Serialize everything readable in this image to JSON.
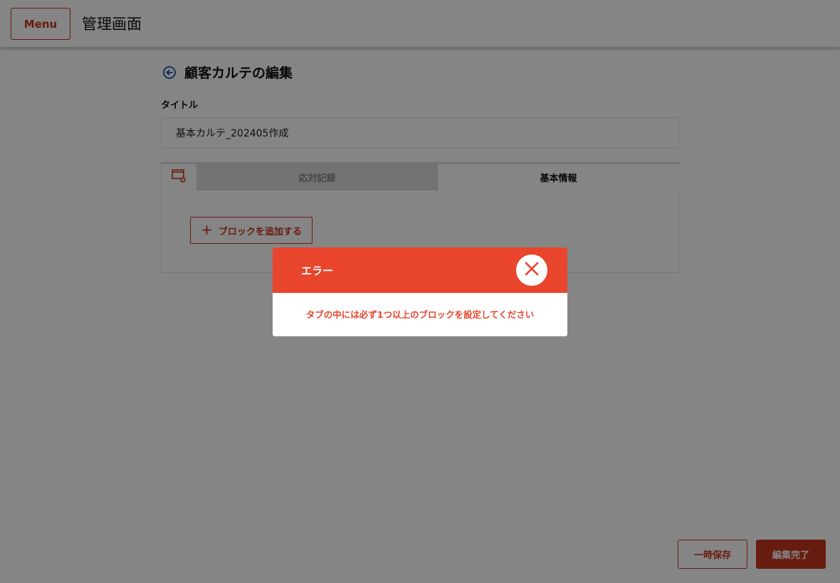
{
  "header": {
    "menu_label": "Menu",
    "app_title": "管理画面"
  },
  "page": {
    "title": "顧客カルテの編集",
    "title_field_label": "タイトル",
    "title_field_value": "基本カルテ_202405作成"
  },
  "tabs": [
    {
      "label": "応対記録",
      "active": false
    },
    {
      "label": "基本情報",
      "active": true
    }
  ],
  "tab_panel": {
    "add_block_label": "ブロックを追加する"
  },
  "footer": {
    "save_draft_label": "一時保存",
    "finish_label": "編集完了"
  },
  "modal": {
    "title": "エラー",
    "message": "タブの中には必ず1つ以上のブロックを設定してください"
  },
  "colors": {
    "accent": "#c8361e",
    "error": "#e8452c",
    "link": "#1a4fa0"
  },
  "icons": {
    "back": "arrow-left-circle-icon",
    "tab_settings": "settings-window-icon",
    "add": "plus-icon",
    "close": "close-icon"
  }
}
